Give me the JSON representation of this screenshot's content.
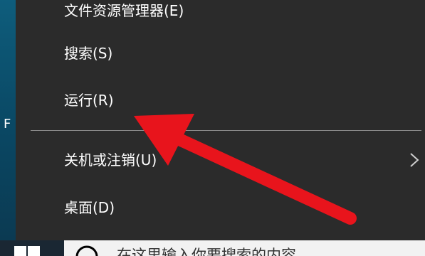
{
  "desktop": {
    "partial_label": "F"
  },
  "menu": {
    "items": [
      {
        "label": "文件资源管理器(E)"
      },
      {
        "label": "搜索(S)"
      },
      {
        "label": "运行(R)"
      },
      {
        "label": "关机或注销(U)",
        "has_submenu": true
      },
      {
        "label": "桌面(D)"
      }
    ],
    "submenu_icon": "chevron-right-icon"
  },
  "taskbar": {
    "start_icon": "windows-logo-icon",
    "search_icon": "search-icon",
    "search_placeholder": "在这里输入你要搜索的内容"
  },
  "annotation": {
    "type": "arrow",
    "color": "#e8141c",
    "points_to": "运行(R)"
  },
  "colors": {
    "menu_background": "#2b2b2b",
    "menu_text": "#ffffff",
    "divider": "#8a8a8a",
    "taskbar": "#101b24",
    "search_box": "#f2f2f2",
    "arrow": "#e8141c"
  }
}
